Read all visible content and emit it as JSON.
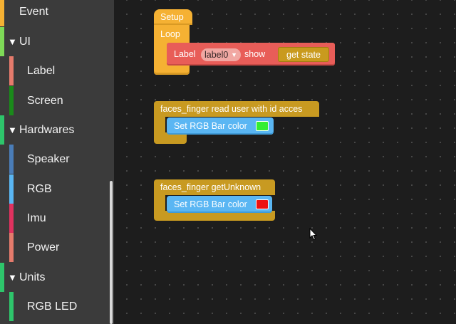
{
  "sidebar": {
    "categories": [
      {
        "label": "Event",
        "color": "#f5b133",
        "kind": "top"
      },
      {
        "label": "UI",
        "color": "#7ed957",
        "kind": "expand"
      },
      {
        "label": "Label",
        "color": "#e57b6c",
        "kind": "sub"
      },
      {
        "label": "Screen",
        "color": "#1a8a1a",
        "kind": "sub"
      },
      {
        "label": "Hardwares",
        "color": "#2ec56b",
        "kind": "expand"
      },
      {
        "label": "Speaker",
        "color": "#4a7db8",
        "kind": "sub"
      },
      {
        "label": "RGB",
        "color": "#5ab6f3",
        "kind": "sub"
      },
      {
        "label": "Imu",
        "color": "#e0325f",
        "kind": "sub"
      },
      {
        "label": "Power",
        "color": "#e57b6c",
        "kind": "sub"
      },
      {
        "label": "Units",
        "color": "#2ec56b",
        "kind": "expand"
      },
      {
        "label": "RGB LED",
        "color": "#2ec56b",
        "kind": "sub"
      }
    ]
  },
  "workspace": {
    "setup_label": "Setup",
    "loop_label": "Loop",
    "label_block": {
      "prefix": "Label",
      "dropdown_value": "label0",
      "action": "show",
      "value_block": "get state"
    },
    "faces_read": {
      "header": "faces_finger read user with id acces",
      "child_label": "Set RGB Bar color",
      "child_color": "#33ee33"
    },
    "faces_unknown": {
      "header": "faces_finger getUnknown",
      "child_label": "Set RGB Bar color",
      "child_color": "#ee1111"
    }
  }
}
